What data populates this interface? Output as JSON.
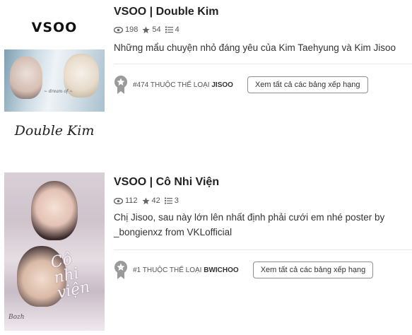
{
  "stories": [
    {
      "title": "VSOO | Double Kim",
      "reads": "198",
      "votes": "54",
      "parts": "4",
      "description": "Những mẩu chuyện nhỏ đáng yêu của Kim Taehyung và Kim Jisoo",
      "rank_number": "#474",
      "rank_label": "THUỘC THỂ LOẠI",
      "rank_tag": "JISOO",
      "rank_button": "Xem tất cả các bảng xếp hạng",
      "cover": {
        "brand": "VSOO",
        "script": "Double Kim",
        "caption": "~ dream of ~"
      }
    },
    {
      "title": "VSOO | Cô Nhi Viện",
      "reads": "112",
      "votes": "42",
      "parts": "3",
      "description": "Chị Jisoo, sau này lớn lên nhất định phải cưới em nhé poster by _bongienxz from VKLofficial",
      "rank_number": "#1",
      "rank_label": "THUỘC THỂ LOẠI",
      "rank_tag": "BWICHOO",
      "rank_button": "Xem tất cả các bảng xếp hạng",
      "cover": {
        "title": "Cô nhi viện",
        "sign": "Bozh"
      }
    }
  ],
  "colors": {
    "badge": "#9a9a9a",
    "meta_icon": "#666666",
    "button_border": "#8f8f8f"
  },
  "icons": {
    "reads": "eye-icon",
    "votes": "star-icon",
    "parts": "list-icon",
    "rank": "ranking-badge-icon"
  }
}
